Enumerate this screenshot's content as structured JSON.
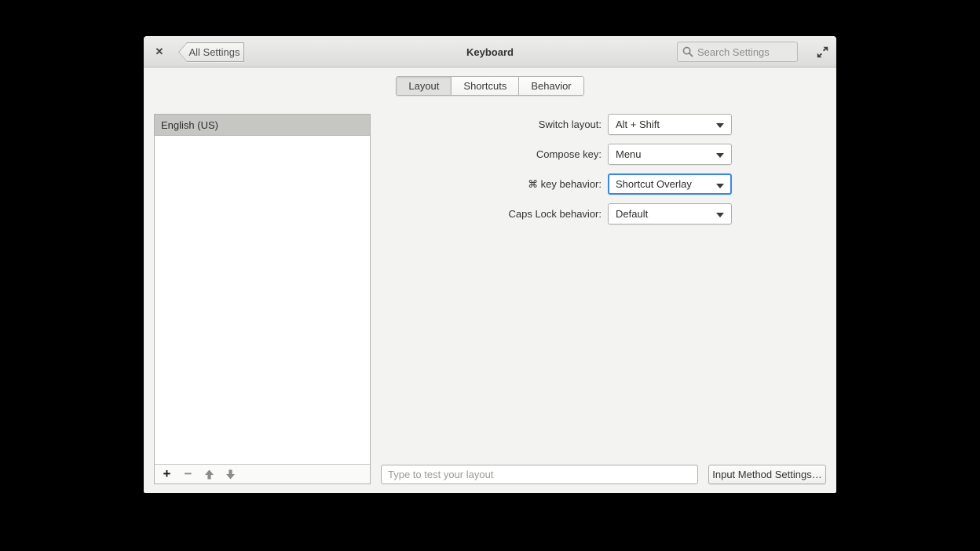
{
  "header": {
    "close_glyph": "✕",
    "back_button_label": "All Settings",
    "title": "Keyboard",
    "search_placeholder": "Search Settings"
  },
  "tabs": [
    {
      "label": "Layout",
      "selected": true
    },
    {
      "label": "Shortcuts",
      "selected": false
    },
    {
      "label": "Behavior",
      "selected": false
    }
  ],
  "layout_list": {
    "items": [
      {
        "label": "English (US)",
        "selected": true
      }
    ],
    "toolbar": {
      "add_glyph": "+",
      "remove_glyph": "−",
      "move_up_icon": "arrow-up-icon",
      "move_down_icon": "arrow-down-icon"
    }
  },
  "form": {
    "rows": [
      {
        "label": "Switch layout:",
        "value": "Alt + Shift",
        "focused": false
      },
      {
        "label": "Compose key:",
        "value": "Menu",
        "focused": false
      },
      {
        "label": "⌘ key behavior:",
        "value": "Shortcut Overlay",
        "focused": true
      },
      {
        "label": "Caps Lock behavior:",
        "value": "Default",
        "focused": false
      }
    ]
  },
  "footer": {
    "test_input_placeholder": "Type to test your layout",
    "input_method_button_label": "Input Method Settings…"
  },
  "colors": {
    "accent": "#3689e6",
    "header_top": "#eeeeec",
    "header_bottom": "#dcdcda",
    "body_background": "#f3f3f1",
    "selected_row": "#c6c6c3"
  }
}
